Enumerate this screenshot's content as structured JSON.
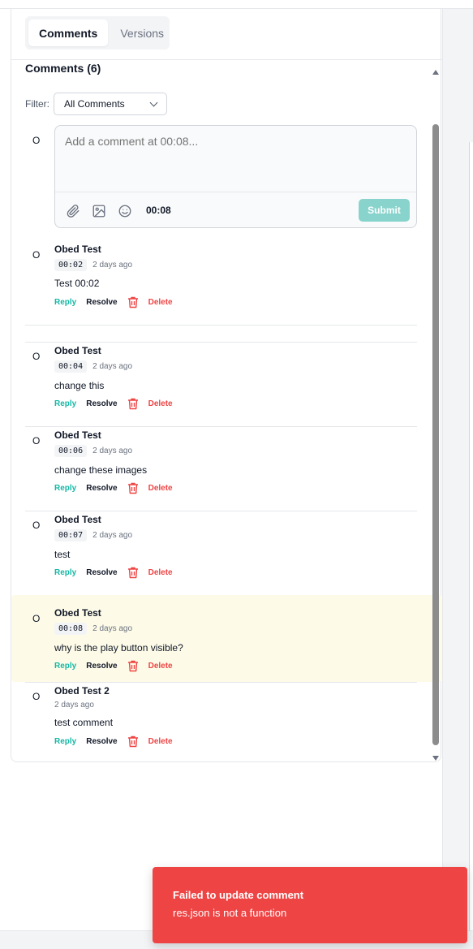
{
  "tabs": [
    {
      "label": "Comments",
      "active": true
    },
    {
      "label": "Versions",
      "active": false
    }
  ],
  "comments_heading": "Comments (6)",
  "filter": {
    "label": "Filter:",
    "selected": "All Comments"
  },
  "composer": {
    "avatar": "O",
    "placeholder": "Add a comment at 00:08...",
    "timecode": "00:08",
    "submit_label": "Submit",
    "tools": [
      "paperclip-icon",
      "image-icon",
      "smiley-icon"
    ]
  },
  "actions": {
    "reply": "Reply",
    "resolve": "Resolve",
    "delete": "Delete"
  },
  "comments": [
    {
      "avatar": "O",
      "author": "Obed Test",
      "timestamp": "00:02",
      "time_ago": "2 days ago",
      "text": "Test 00:02"
    },
    {
      "avatar": "O",
      "author": "Obed Test",
      "timestamp": "00:04",
      "time_ago": "2 days ago",
      "text": "change this"
    },
    {
      "avatar": "O",
      "author": "Obed Test",
      "timestamp": "00:06",
      "time_ago": "2 days ago",
      "text": "change these images"
    },
    {
      "avatar": "O",
      "author": "Obed Test",
      "timestamp": "00:07",
      "time_ago": "2 days ago",
      "text": "test"
    },
    {
      "avatar": "O",
      "author": "Obed Test",
      "timestamp": "00:08",
      "time_ago": "2 days ago",
      "text": "why is the play button visible?",
      "highlighted": true
    },
    {
      "avatar": "O",
      "author": "Obed Test 2",
      "timestamp": "",
      "time_ago": "2 days ago",
      "text": "test comment"
    }
  ],
  "toast": {
    "title": "Failed to update comment",
    "message": "res.json is not a function"
  },
  "colors": {
    "accent": "#14b8a6",
    "danger": "#ef4444",
    "submit_disabled": "#88d4cc",
    "highlight": "#fdfbe8"
  }
}
